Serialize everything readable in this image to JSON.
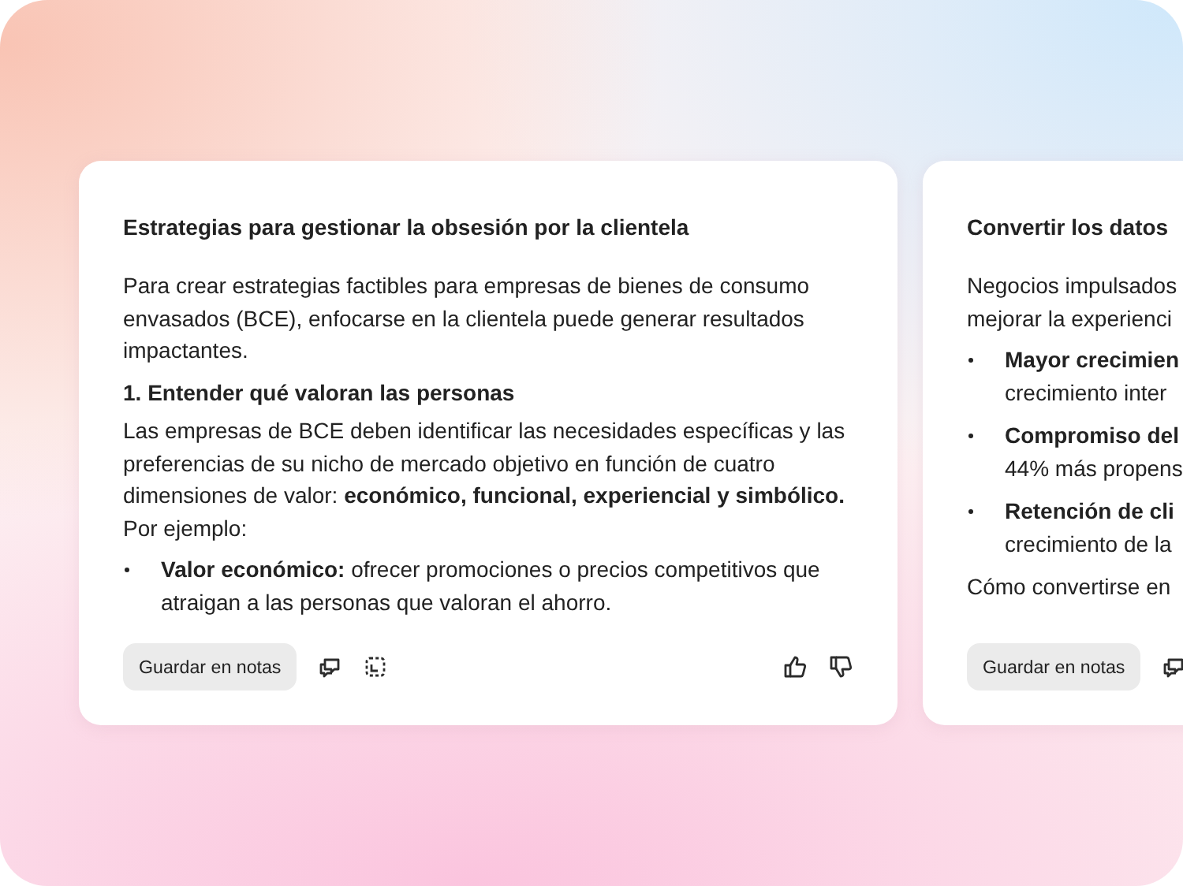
{
  "cards": [
    {
      "partial": false,
      "title": "Estrategias para gestionar la obsesión por la clientela",
      "blocks": [
        {
          "kind": "paragraph",
          "lines": [
            "Para crear estrategias factibles para empresas de bienes de consumo envasados (BCE), enfocarse en la clientela puede generar resultados impactantes."
          ]
        },
        {
          "kind": "heading",
          "text": "1. Entender qué valoran las personas"
        },
        {
          "kind": "paragraph",
          "lines": [
            "Las empresas de BCE deben identificar las necesidades específicas y las preferencias de su nicho de mercado objetivo en función de cuatro dimensiones de valor: **económico, funcional, experiencial y simbólico.** Por ejemplo:"
          ]
        },
        {
          "kind": "bullet",
          "lead": "Valor económico:",
          "text": "ofrecer promociones o precios competitivos que atraigan a las personas que valoran el ahorro."
        }
      ],
      "save_button": "Guardar en notas",
      "feedback": true
    },
    {
      "partial": true,
      "title": "Convertir los datos",
      "blocks": [
        {
          "kind": "paragraph",
          "lines": [
            "Negocios impulsados",
            "mejorar la experienci"
          ]
        },
        {
          "kind": "bullet",
          "lead": "Mayor crecimien",
          "text": "crecimiento inter"
        },
        {
          "kind": "bullet",
          "lead": "Compromiso del",
          "text": "44% más propens"
        },
        {
          "kind": "bullet",
          "lead": "Retención de cli",
          "text": "crecimiento de la"
        },
        {
          "kind": "paragraph",
          "lines": [
            "Cómo convertirse en"
          ]
        }
      ],
      "save_button": "Guardar en notas",
      "feedback": false
    }
  ]
}
